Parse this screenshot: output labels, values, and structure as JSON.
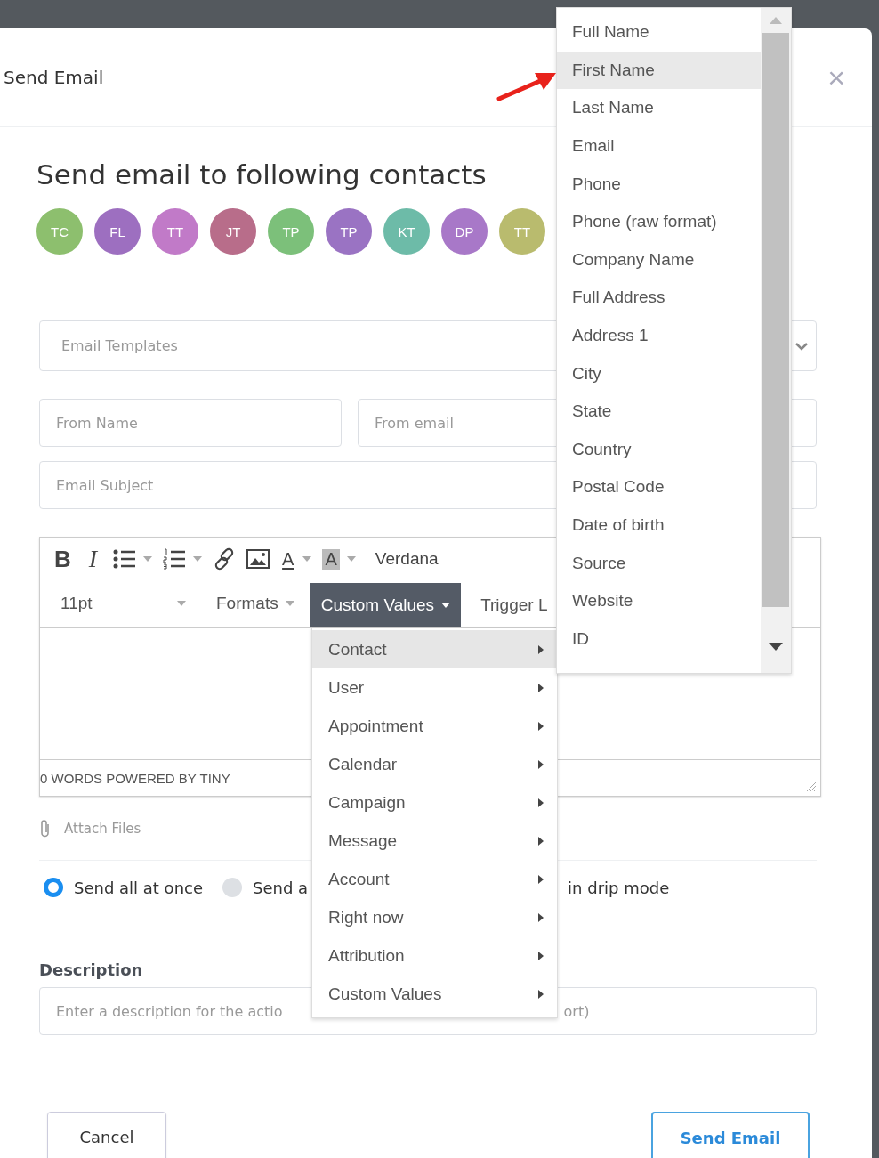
{
  "modal": {
    "title": "Send Email",
    "close": "×"
  },
  "heading": "Send email to following contacts",
  "contacts": [
    {
      "initials": "TC",
      "color": "#8dbf6e"
    },
    {
      "initials": "FL",
      "color": "#9d6fc0"
    },
    {
      "initials": "TT",
      "color": "#c17ac8"
    },
    {
      "initials": "JT",
      "color": "#b86d8a"
    },
    {
      "initials": "TP",
      "color": "#7cc07a"
    },
    {
      "initials": "TP",
      "color": "#9a73c3"
    },
    {
      "initials": "KT",
      "color": "#6dbba8"
    },
    {
      "initials": "DP",
      "color": "#a878c8"
    },
    {
      "initials": "TT",
      "color": "#b9bb6e"
    }
  ],
  "template_select": {
    "placeholder": "Email Templates"
  },
  "from_name": {
    "placeholder": "From Name"
  },
  "from_email": {
    "placeholder": "From email"
  },
  "subject": {
    "placeholder": "Email Subject"
  },
  "editor": {
    "toolbar_row_1": [
      {
        "kind": "bold",
        "label": "B"
      },
      {
        "kind": "italic",
        "label": "I"
      },
      {
        "kind": "bullet_list"
      },
      {
        "kind": "numbered_list"
      },
      {
        "kind": "link"
      },
      {
        "kind": "image"
      },
      {
        "kind": "text_color",
        "label": "A"
      },
      {
        "kind": "background_color",
        "label": "A"
      },
      {
        "kind": "font",
        "label": "Verdana"
      }
    ],
    "toolbar_row_2": [
      {
        "kind": "select",
        "label": "11pt",
        "selected": false
      },
      {
        "kind": "select",
        "label": "Formats",
        "selected": false
      },
      {
        "kind": "menu",
        "label": "Custom Values",
        "selected": true
      },
      {
        "kind": "menu",
        "label": "Trigger L",
        "selected": false
      }
    ],
    "status": "0 WORDS POWERED BY TINY"
  },
  "attach": {
    "label": "Attach Files"
  },
  "send_modes": [
    {
      "label": "Send all at once",
      "selected": true
    },
    {
      "label": "Send a",
      "label_after_menu": "in drip mode",
      "selected": false
    }
  ],
  "description": {
    "label": "Description",
    "placeholder": "Enter a description for the actio",
    "placeholder_after_menu": "ort)"
  },
  "buttons": {
    "cancel": "Cancel",
    "send": "Send Email"
  },
  "custom_values_menu": [
    {
      "label": "Contact",
      "selected": true
    },
    {
      "label": "User",
      "selected": false
    },
    {
      "label": "Appointment",
      "selected": false
    },
    {
      "label": "Calendar",
      "selected": false
    },
    {
      "label": "Campaign",
      "selected": false
    },
    {
      "label": "Message",
      "selected": false
    },
    {
      "label": "Account",
      "selected": false
    },
    {
      "label": "Right now",
      "selected": false
    },
    {
      "label": "Attribution",
      "selected": false
    },
    {
      "label": "Custom Values",
      "selected": false
    }
  ],
  "contact_submenu": [
    {
      "label": "Full Name",
      "selected": false
    },
    {
      "label": "First Name",
      "selected": true
    },
    {
      "label": "Last Name",
      "selected": false
    },
    {
      "label": "Email",
      "selected": false
    },
    {
      "label": "Phone",
      "selected": false
    },
    {
      "label": "Phone (raw format)",
      "selected": false
    },
    {
      "label": "Company Name",
      "selected": false
    },
    {
      "label": "Full Address",
      "selected": false
    },
    {
      "label": "Address 1",
      "selected": false
    },
    {
      "label": "City",
      "selected": false
    },
    {
      "label": "State",
      "selected": false
    },
    {
      "label": "Country",
      "selected": false
    },
    {
      "label": "Postal Code",
      "selected": false
    },
    {
      "label": "Date of birth",
      "selected": false
    },
    {
      "label": "Source",
      "selected": false
    },
    {
      "label": "Website",
      "selected": false
    },
    {
      "label": "ID",
      "selected": false
    }
  ]
}
